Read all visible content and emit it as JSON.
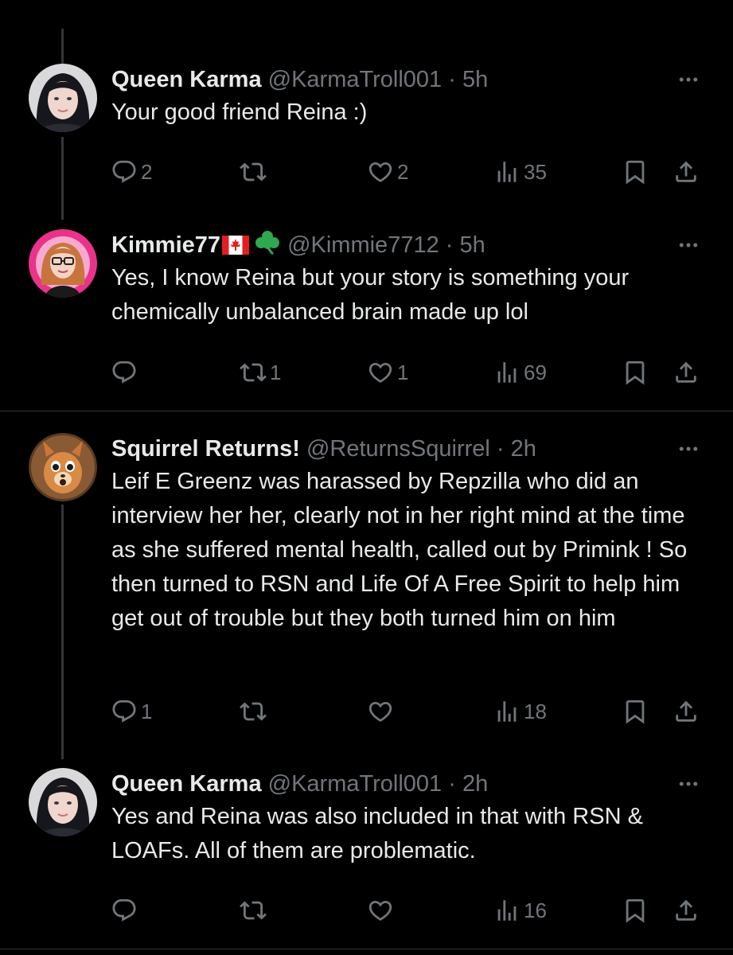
{
  "tweets": [
    {
      "name": "Queen Karma",
      "handle": "@KarmaTroll001",
      "separator": "·",
      "time": "5h",
      "text": "Your good friend Reina :)",
      "avatar_icon": "woman-dark-hair-avatar",
      "replies": "2",
      "retweets": "",
      "likes": "2",
      "views": "35"
    },
    {
      "name": "Kimmie77",
      "emojis": [
        "canada-flag-icon",
        "shamrock-icon"
      ],
      "handle": "@Kimmie7712",
      "separator": "·",
      "time": "5h",
      "text": "Yes, I know Reina but your story is something your chemically unbalanced brain made up lol",
      "avatar_icon": "pink-glasses-avatar",
      "replies": "",
      "retweets": "1",
      "likes": "1",
      "views": "69"
    },
    {
      "name": "Squirrel Returns!",
      "handle": "@ReturnsSquirrel",
      "separator": "·",
      "time": "2h",
      "text": "Leif E Greenz was harassed by Repzilla who did an interview her her, clearly not in her right mind at the time as she suffered mental health, called out by Primink ! So then turned to RSN and Life Of A Free Spirit to help him get out of trouble but they both turned him on him",
      "avatar_icon": "squirrel-avatar",
      "replies": "1",
      "retweets": "",
      "likes": "",
      "views": "18"
    },
    {
      "name": "Queen Karma",
      "handle": "@KarmaTroll001",
      "separator": "·",
      "time": "2h",
      "text": "Yes and Reina was also included in that with RSN & LOAFs. All of them are problematic.",
      "avatar_icon": "woman-dark-hair-avatar",
      "replies": "",
      "retweets": "",
      "likes": "",
      "views": "16"
    }
  ],
  "colors": {
    "background": "#000000",
    "primary_text": "#e7e9ea",
    "secondary_text": "#71767b",
    "divider": "#2f3336",
    "thread_line": "#333639"
  }
}
